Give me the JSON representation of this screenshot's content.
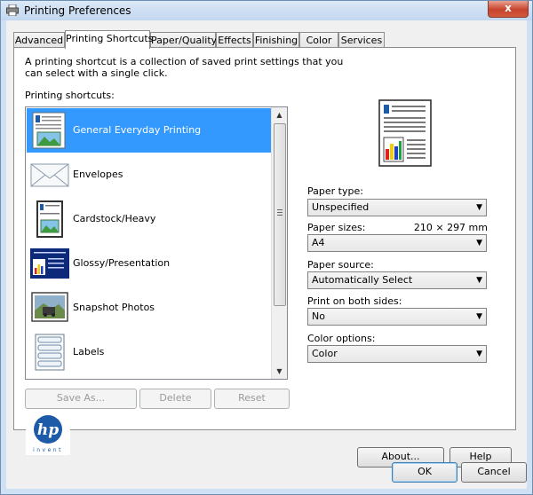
{
  "window": {
    "title": "Printing Preferences",
    "close_glyph": "x"
  },
  "tabs": [
    {
      "label": "Advanced"
    },
    {
      "label": "Printing Shortcuts"
    },
    {
      "label": "Paper/Quality"
    },
    {
      "label": "Effects"
    },
    {
      "label": "Finishing"
    },
    {
      "label": "Color"
    },
    {
      "label": "Services"
    }
  ],
  "intro_text": "A printing shortcut is a collection of saved print settings that you can select with a single click.",
  "shortcuts_label": "Printing shortcuts:",
  "shortcuts": [
    {
      "label": "General Everyday Printing",
      "icon": "document-image-icon"
    },
    {
      "label": "Envelopes",
      "icon": "envelope-icon"
    },
    {
      "label": "Cardstock/Heavy",
      "icon": "cardstock-icon"
    },
    {
      "label": "Glossy/Presentation",
      "icon": "presentation-icon"
    },
    {
      "label": "Snapshot Photos",
      "icon": "photo-icon"
    },
    {
      "label": "Labels",
      "icon": "labels-icon"
    }
  ],
  "list_buttons": {
    "save_as": "Save As...",
    "delete": "Delete",
    "reset": "Reset"
  },
  "fields": {
    "paper_type": {
      "label": "Paper type:",
      "value": "Unspecified"
    },
    "paper_sizes": {
      "label": "Paper sizes:",
      "value": "A4",
      "dimension": "210 × 297 mm"
    },
    "paper_source": {
      "label": "Paper source:",
      "value": "Automatically Select"
    },
    "both_sides": {
      "label": "Print on both sides:",
      "value": "No"
    },
    "color_options": {
      "label": "Color options:",
      "value": "Color"
    }
  },
  "panel_buttons": {
    "about": "About...",
    "help": "Help"
  },
  "dialog_buttons": {
    "ok": "OK",
    "cancel": "Cancel"
  },
  "logo": {
    "brand": "hp",
    "tagline": "invent"
  },
  "colors": {
    "selection": "#3399ff",
    "hp_blue": "#1d5aa7",
    "bar_red": "#e02020",
    "bar_green": "#20a040",
    "bar_blue": "#2040c8",
    "bar_yellow": "#f0d000"
  }
}
